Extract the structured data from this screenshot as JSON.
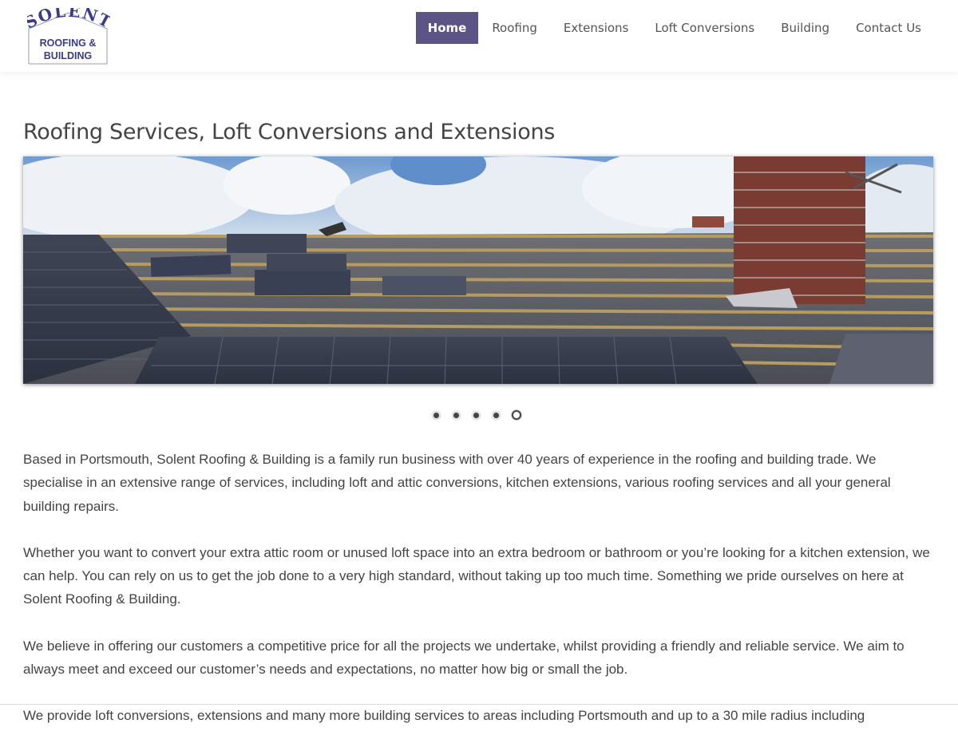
{
  "logo": {
    "name": "SOLENT",
    "line1": "ROOFING &",
    "line2": "BUILDING"
  },
  "nav": {
    "items": [
      {
        "label": "Home",
        "active": true
      },
      {
        "label": "Roofing",
        "active": false
      },
      {
        "label": "Extensions",
        "active": false
      },
      {
        "label": "Loft Conversions",
        "active": false
      },
      {
        "label": "Building",
        "active": false
      },
      {
        "label": "Contact Us",
        "active": false
      }
    ]
  },
  "page": {
    "title": "Roofing Services, Loft Conversions and Extensions"
  },
  "slider": {
    "image_description": "roof-slating-photo",
    "dot_count": 5,
    "active_dot": 5
  },
  "content": {
    "paragraphs": [
      "Based in Portsmouth, Solent Roofing & Building is a family run business with over 40 years of experience in the roofing and building trade. We specialise in an extensive range of services, including loft and attic conversions, kitchen extensions, various roofing services and all your general building repairs.",
      "Whether you want to convert your extra attic room or unused loft space into an extra bedroom or bathroom or you’re looking for a kitchen extension, we can help. You can rely on us to get the job done to a very high standard, without taking up too much time. Something we pride ourselves on here at Solent Roofing & Building.",
      "We believe in offering our customers a competitive price for all the projects we undertake, whilst providing a friendly and reliable service. We aim to always meet and exceed our customer’s needs and expectations, no matter how big or small the job.",
      "We provide loft conversions, extensions and many more building services to areas including Portsmouth and up to a 30 mile radius including"
    ]
  },
  "colors": {
    "accent": "#5b5485",
    "text": "#444444",
    "logo_blue": "#3b3b8c"
  }
}
